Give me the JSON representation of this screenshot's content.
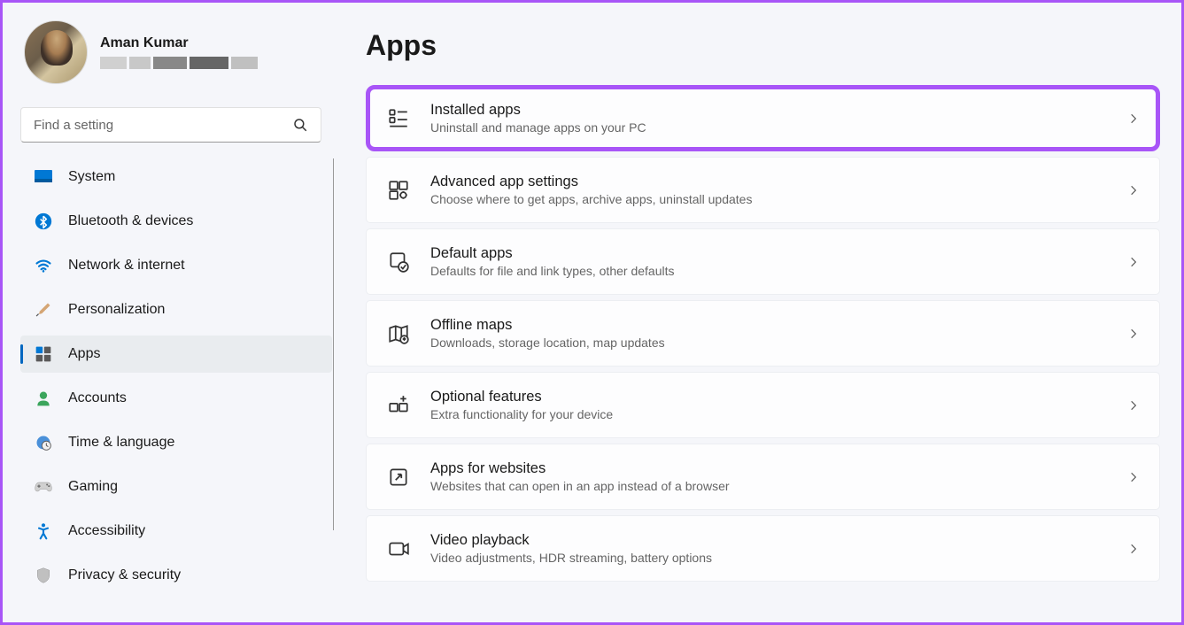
{
  "profile": {
    "name": "Aman Kumar"
  },
  "search": {
    "placeholder": "Find a setting"
  },
  "nav": [
    {
      "id": "system",
      "label": "System"
    },
    {
      "id": "bluetooth",
      "label": "Bluetooth & devices"
    },
    {
      "id": "network",
      "label": "Network & internet"
    },
    {
      "id": "personalization",
      "label": "Personalization"
    },
    {
      "id": "apps",
      "label": "Apps"
    },
    {
      "id": "accounts",
      "label": "Accounts"
    },
    {
      "id": "time",
      "label": "Time & language"
    },
    {
      "id": "gaming",
      "label": "Gaming"
    },
    {
      "id": "accessibility",
      "label": "Accessibility"
    },
    {
      "id": "privacy",
      "label": "Privacy & security"
    }
  ],
  "page": {
    "title": "Apps"
  },
  "cards": [
    {
      "id": "installed",
      "title": "Installed apps",
      "desc": "Uninstall and manage apps on your PC"
    },
    {
      "id": "advanced",
      "title": "Advanced app settings",
      "desc": "Choose where to get apps, archive apps, uninstall updates"
    },
    {
      "id": "default",
      "title": "Default apps",
      "desc": "Defaults for file and link types, other defaults"
    },
    {
      "id": "offline",
      "title": "Offline maps",
      "desc": "Downloads, storage location, map updates"
    },
    {
      "id": "optional",
      "title": "Optional features",
      "desc": "Extra functionality for your device"
    },
    {
      "id": "websites",
      "title": "Apps for websites",
      "desc": "Websites that can open in an app instead of a browser"
    },
    {
      "id": "video",
      "title": "Video playback",
      "desc": "Video adjustments, HDR streaming, battery options"
    }
  ],
  "state": {
    "activeNav": "apps",
    "highlightedCard": "installed"
  }
}
